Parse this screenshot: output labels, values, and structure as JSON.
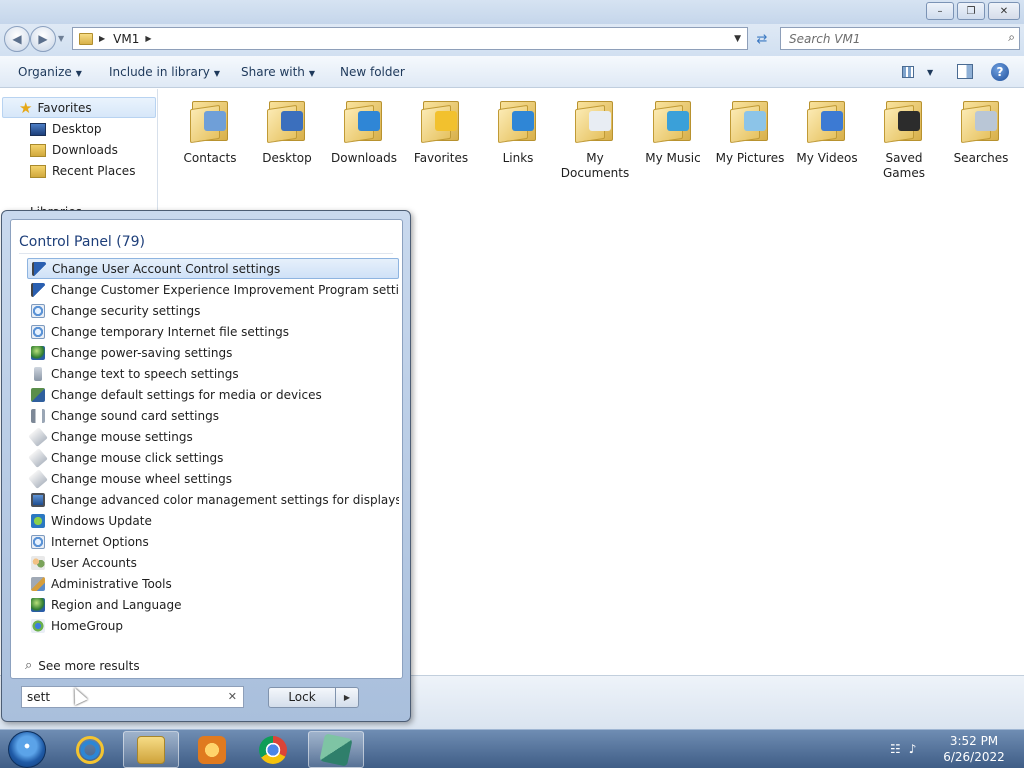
{
  "window": {
    "caption_buttons": [
      "minimize",
      "maximize",
      "close"
    ]
  },
  "address": {
    "path": "VM1",
    "search_placeholder": "Search VM1"
  },
  "toolbar": {
    "organize": "Organize",
    "include": "Include in library",
    "share": "Share with",
    "new_folder": "New folder"
  },
  "nav": {
    "favorites": "Favorites",
    "items": [
      {
        "label": "Desktop",
        "icon": "desktop-icon"
      },
      {
        "label": "Downloads",
        "icon": "downloads-icon"
      },
      {
        "label": "Recent Places",
        "icon": "recent-places-icon"
      }
    ],
    "libraries": "Libraries"
  },
  "folders": [
    {
      "label": "Contacts",
      "badge": "#6f9fd8"
    },
    {
      "label": "Desktop",
      "badge": "#3b6fbd"
    },
    {
      "label": "Downloads",
      "badge": "#2f86d6"
    },
    {
      "label": "Favorites",
      "badge": "#f2c12e"
    },
    {
      "label": "Links",
      "badge": "#2f86d6"
    },
    {
      "label": "My Documents",
      "badge": "#e8edf3"
    },
    {
      "label": "My Music",
      "badge": "#3aa0d9"
    },
    {
      "label": "My Pictures",
      "badge": "#8cc4e8"
    },
    {
      "label": "My Videos",
      "badge": "#3c7ad3"
    },
    {
      "label": "Saved Games",
      "badge": "#2c2c2c"
    },
    {
      "label": "Searches",
      "badge": "#b9c6d6"
    }
  ],
  "start_menu": {
    "header": "Control Panel (79)",
    "items": [
      {
        "label": "Change User Account Control settings",
        "icon": "flag-icon",
        "selected": true
      },
      {
        "label": "Change Customer Experience Improvement Program settings",
        "icon": "flag-icon",
        "selected": false
      },
      {
        "label": "Change security settings",
        "icon": "internet-options-icon",
        "selected": false
      },
      {
        "label": "Change temporary Internet file settings",
        "icon": "internet-options-icon",
        "selected": false
      },
      {
        "label": "Change power-saving settings",
        "icon": "power-icon",
        "selected": false
      },
      {
        "label": "Change text to speech settings",
        "icon": "microphone-icon",
        "selected": false
      },
      {
        "label": "Change default settings for media or devices",
        "icon": "autoplay-icon",
        "selected": false
      },
      {
        "label": "Change sound card settings",
        "icon": "speaker-icon",
        "selected": false
      },
      {
        "label": "Change mouse settings",
        "icon": "mouse-icon",
        "selected": false
      },
      {
        "label": "Change mouse click settings",
        "icon": "mouse-icon",
        "selected": false
      },
      {
        "label": "Change mouse wheel settings",
        "icon": "mouse-icon",
        "selected": false
      },
      {
        "label": "Change advanced color management settings for displays, sca...",
        "icon": "monitor-icon",
        "selected": false
      },
      {
        "label": "Windows Update",
        "icon": "windows-update-icon",
        "selected": false
      },
      {
        "label": "Internet Options",
        "icon": "internet-options-icon",
        "selected": false
      },
      {
        "label": "User Accounts",
        "icon": "user-accounts-icon",
        "selected": false
      },
      {
        "label": "Administrative Tools",
        "icon": "admin-tools-icon",
        "selected": false
      },
      {
        "label": "Region and Language",
        "icon": "globe-icon",
        "selected": false
      },
      {
        "label": "HomeGroup",
        "icon": "homegroup-icon",
        "selected": false
      }
    ],
    "see_more": "See more results",
    "search_value": "sett",
    "lock_label": "Lock"
  },
  "taskbar": {
    "apps": [
      "internet-explorer",
      "windows-explorer",
      "media-player",
      "chrome",
      "setup-installer"
    ],
    "time": "3:52 PM",
    "date": "6/26/2022"
  }
}
